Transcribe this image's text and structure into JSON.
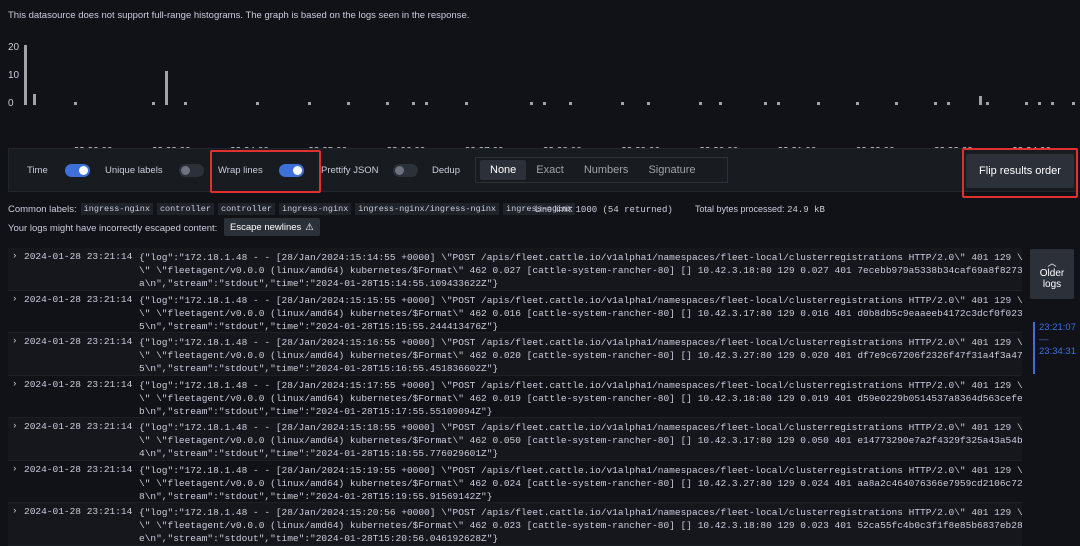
{
  "notice": "This datasource does not support full-range histograms. The graph is based on the logs seen in the response.",
  "histogram": {
    "y_ticks": [
      "20",
      "10",
      "0"
    ],
    "x_ticks": [
      "23:22:00",
      "23:23:00",
      "23:24:00",
      "23:25:00",
      "23:26:00",
      "23:27:00",
      "23:28:00",
      "23:29:00",
      "23:30:00",
      "23:31:00",
      "23:32:00",
      "23:33:00",
      "23:34:00"
    ],
    "legend": "unknown",
    "bar_color": "#9fa2a8"
  },
  "chart_data": {
    "type": "bar",
    "title": "",
    "xlabel": "",
    "ylabel": "",
    "ylim": [
      0,
      22
    ],
    "series": [
      {
        "name": "unknown",
        "values": [
          21,
          4,
          1,
          1,
          12,
          1,
          1,
          1,
          1,
          1,
          1,
          1,
          1,
          1,
          1,
          1,
          1,
          1,
          1,
          1,
          1,
          1,
          1,
          1,
          1,
          1,
          1,
          1,
          1,
          1,
          1,
          3,
          1
        ]
      }
    ],
    "x": [
      "23:21:07",
      "23:21:14",
      "23:21:45",
      "23:22:45",
      "23:22:55",
      "23:23:10",
      "23:24:05",
      "23:24:45",
      "23:25:15",
      "23:25:45",
      "23:26:05",
      "23:26:15",
      "23:26:45",
      "23:27:35",
      "23:27:45",
      "23:28:05",
      "23:28:45",
      "23:29:05",
      "23:29:45",
      "23:30:00",
      "23:30:35",
      "23:30:45",
      "23:31:15",
      "23:31:45",
      "23:32:15",
      "23:32:45",
      "23:32:55",
      "23:33:25",
      "23:33:55",
      "23:34:05",
      "23:34:15",
      "23:33:20",
      "23:34:31"
    ]
  },
  "controls": {
    "time": {
      "label": "Time",
      "on": true
    },
    "unique_labels": {
      "label": "Unique labels",
      "on": false
    },
    "wrap_lines": {
      "label": "Wrap lines",
      "on": true
    },
    "prettify": {
      "label": "Prettify JSON",
      "on": false
    },
    "dedup_label": "Dedup",
    "dedup_options": [
      "None",
      "Exact",
      "Numbers",
      "Signature"
    ],
    "dedup_selected": "None",
    "flip_button": "Flip results order"
  },
  "common_labels": {
    "label": "Common labels:",
    "chips": [
      "ingress-nginx",
      "controller",
      "controller",
      "ingress-nginx",
      "ingress-nginx/ingress-nginx",
      "ingress-nginx"
    ],
    "line_limit_label": "Line limit:",
    "line_limit_value": "1000 (54 returned)",
    "bytes_label": "Total bytes processed:",
    "bytes_value": "24.9 kB"
  },
  "escape": {
    "note": "Your logs might have incorrectly escaped content:",
    "button": "Escape newlines"
  },
  "logs": [
    {
      "ts": "2024-01-28 23:21:14",
      "line1": "{\"log\":\"172.18.1.48 - - [28/Jan/2024:15:14:55 +0000] \\\"POST /apis/fleet.cattle.io/v1alpha1/namespaces/fleet-local/clusterregistrations HTTP/2.0\\\" 401 129 \\\"-",
      "line2": "\\\" \\\"fleetagent/v0.0.0 (linux/amd64) kubernetes/$Format\\\" 462 0.027 [cattle-system-rancher-80] [] 10.42.3.18:80 129 0.027 401 7ecebb979a5338b34caf69a8f82737f",
      "line3": "a\\n\",\"stream\":\"stdout\",\"time\":\"2024-01-28T15:14:55.109433622Z\"}"
    },
    {
      "ts": "2024-01-28 23:21:14",
      "line1": "{\"log\":\"172.18.1.48 - - [28/Jan/2024:15:15:55 +0000] \\\"POST /apis/fleet.cattle.io/v1alpha1/namespaces/fleet-local/clusterregistrations HTTP/2.0\\\" 401 129 \\\"-",
      "line2": "\\\" \\\"fleetagent/v0.0.0 (linux/amd64) kubernetes/$Format\\\" 462 0.016 [cattle-system-rancher-80] [] 10.42.3.17:80 129 0.016 401 d0b8db5c9eaaeeb4172c3dcf0f02322",
      "line3": "5\\n\",\"stream\":\"stdout\",\"time\":\"2024-01-28T15:15:55.244413476Z\"}"
    },
    {
      "ts": "2024-01-28 23:21:14",
      "line1": "{\"log\":\"172.18.1.48 - - [28/Jan/2024:15:16:55 +0000] \\\"POST /apis/fleet.cattle.io/v1alpha1/namespaces/fleet-local/clusterregistrations HTTP/2.0\\\" 401 129 \\\"-",
      "line2": "\\\" \\\"fleetagent/v0.0.0 (linux/amd64) kubernetes/$Format\\\" 462 0.020 [cattle-system-rancher-80] [] 10.42.3.27:80 129 0.020 401 df7e9c67206f2326f47f31a4f3a47d4",
      "line3": "5\\n\",\"stream\":\"stdout\",\"time\":\"2024-01-28T15:16:55.451836602Z\"}"
    },
    {
      "ts": "2024-01-28 23:21:14",
      "line1": "{\"log\":\"172.18.1.48 - - [28/Jan/2024:15:17:55 +0000] \\\"POST /apis/fleet.cattle.io/v1alpha1/namespaces/fleet-local/clusterregistrations HTTP/2.0\\\" 401 129 \\\"-",
      "line2": "\\\" \\\"fleetagent/v0.0.0 (linux/amd64) kubernetes/$Format\\\" 462 0.019 [cattle-system-rancher-80] [] 10.42.3.18:80 129 0.019 401 d59e0229b0514537a8364d563cefe19",
      "line3": "b\\n\",\"stream\":\"stdout\",\"time\":\"2024-01-28T15:17:55.55109094Z\"}"
    },
    {
      "ts": "2024-01-28 23:21:14",
      "line1": "{\"log\":\"172.18.1.48 - - [28/Jan/2024:15:18:55 +0000] \\\"POST /apis/fleet.cattle.io/v1alpha1/namespaces/fleet-local/clusterregistrations HTTP/2.0\\\" 401 129 \\\"-",
      "line2": "\\\" \\\"fleetagent/v0.0.0 (linux/amd64) kubernetes/$Format\\\" 462 0.050 [cattle-system-rancher-80] [] 10.42.3.17:80 129 0.050 401 e14773290e7a2f4329f325a43a54b0a",
      "line3": "4\\n\",\"stream\":\"stdout\",\"time\":\"2024-01-28T15:18:55.776029601Z\"}"
    },
    {
      "ts": "2024-01-28 23:21:14",
      "line1": "{\"log\":\"172.18.1.48 - - [28/Jan/2024:15:19:55 +0000] \\\"POST /apis/fleet.cattle.io/v1alpha1/namespaces/fleet-local/clusterregistrations HTTP/2.0\\\" 401 129 \\\"-",
      "line2": "\\\" \\\"fleetagent/v0.0.0 (linux/amd64) kubernetes/$Format\\\" 462 0.024 [cattle-system-rancher-80] [] 10.42.3.27:80 129 0.024 401 aa8a2c464076366e7959cd2106c72ac",
      "line3": "8\\n\",\"stream\":\"stdout\",\"time\":\"2024-01-28T15:19:55.91569142Z\"}"
    },
    {
      "ts": "2024-01-28 23:21:14",
      "line1": "{\"log\":\"172.18.1.48 - - [28/Jan/2024:15:20:56 +0000] \\\"POST /apis/fleet.cattle.io/v1alpha1/namespaces/fleet-local/clusterregistrations HTTP/2.0\\\" 401 129 \\\"-",
      "line2": "\\\" \\\"fleetagent/v0.0.0 (linux/amd64) kubernetes/$Format\\\" 462 0.023 [cattle-system-rancher-80] [] 10.42.3.18:80 129 0.023 401 52ca55fc4b0c3f1f8e85b6837eb282b",
      "line3": "e\\n\",\"stream\":\"stdout\",\"time\":\"2024-01-28T15:20:56.046192628Z\"}"
    }
  ],
  "older_logs": {
    "label_1": "Older",
    "label_2": "logs"
  },
  "time_range": {
    "start": "23:21:07",
    "dash": "—",
    "end": "23:34:31"
  }
}
